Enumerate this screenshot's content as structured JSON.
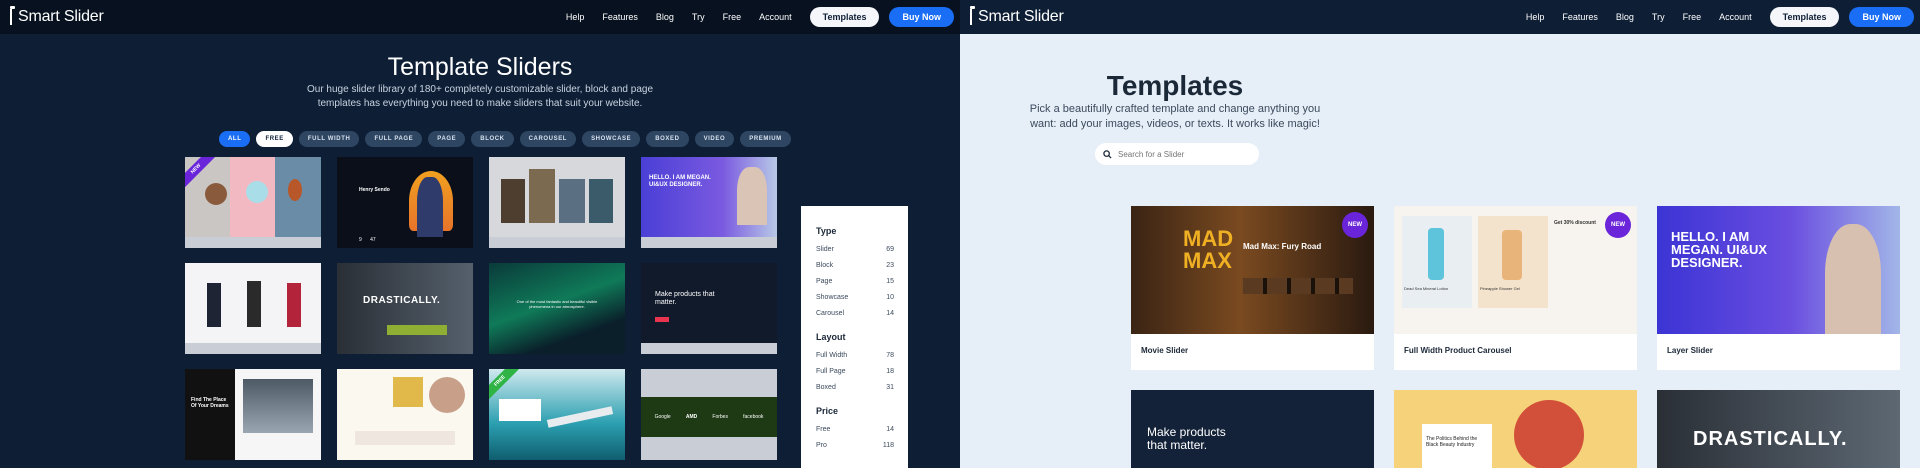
{
  "nav": {
    "logo": "Smart Slider",
    "links": [
      "Help",
      "Features",
      "Blog",
      "Try",
      "Free",
      "Account"
    ],
    "templates_btn": "Templates",
    "buy_btn": "Buy Now"
  },
  "left": {
    "title": "Template Sliders",
    "subtitle": "Our huge slider library of 180+ completely customizable slider, block and page templates has everything you need to make sliders that suit your website.",
    "filters": [
      "ALL",
      "FREE",
      "FULL WIDTH",
      "FULL PAGE",
      "PAGE",
      "BLOCK",
      "CAROUSEL",
      "SHOWCASE",
      "BOXED",
      "VIDEO",
      "PREMIUM"
    ],
    "ribbon_new": "NEW",
    "ribbon_free": "FREE",
    "tile_texts": {
      "henry": "Henry Sendo",
      "henry_nums": "9      47",
      "megan": "HELLO. I AM MEGAN. UI&UX DESIGNER.",
      "drastically": "DRASTICALLY.",
      "aurora": "One of the most fantastic and beautiful visible phenomena in our atmosphere.",
      "products": "Make products that matter.",
      "findplace": "Find The Place Of Your Dreams",
      "logos": [
        "Google",
        "AMD",
        "Forbes",
        "facebook"
      ]
    }
  },
  "right": {
    "title": "Templates",
    "subtitle": "Pick a beautifully crafted template and change anything you want: add your images, videos, or texts. It works like magic!",
    "search_placeholder": "Search for a Slider",
    "sidebar": {
      "type_heading": "Type",
      "type_rows": [
        [
          "Slider",
          "69"
        ],
        [
          "Block",
          "23"
        ],
        [
          "Page",
          "15"
        ],
        [
          "Showcase",
          "10"
        ],
        [
          "Carousel",
          "14"
        ]
      ],
      "layout_heading": "Layout",
      "layout_rows": [
        [
          "Full Width",
          "78"
        ],
        [
          "Full Page",
          "18"
        ],
        [
          "Boxed",
          "31"
        ]
      ],
      "price_heading": "Price",
      "price_rows": [
        [
          "Free",
          "14"
        ],
        [
          "Pro",
          "118"
        ]
      ]
    },
    "cards": [
      {
        "caption": "Movie Slider",
        "badge": "NEW",
        "art_title": "MAD MAX",
        "art_text": "Mad Max: Fury Road"
      },
      {
        "caption": "Full Width Product Carousel",
        "badge": "NEW",
        "art_text": "Get 30% discount",
        "product1": "Dead Sea Mineral Lotion",
        "product2": "Pineapple Shower Gel"
      },
      {
        "caption": "Layer Slider",
        "art_text": "HELLO. I AM MEGAN. UI&UX DESIGNER."
      },
      {
        "caption": "",
        "art_text": "Make products that matter."
      },
      {
        "caption": "",
        "art_text": "The Politics Behind the Black Beauty Industry"
      },
      {
        "caption": "",
        "art_text": "DRASTICALLY."
      }
    ]
  },
  "colors": {
    "left_bg": "#0d1e35",
    "right_bg": "#e6eef8",
    "accent_blue": "#1a6ef5",
    "new_purple": "#6a24d9",
    "free_green": "#2fb344"
  }
}
